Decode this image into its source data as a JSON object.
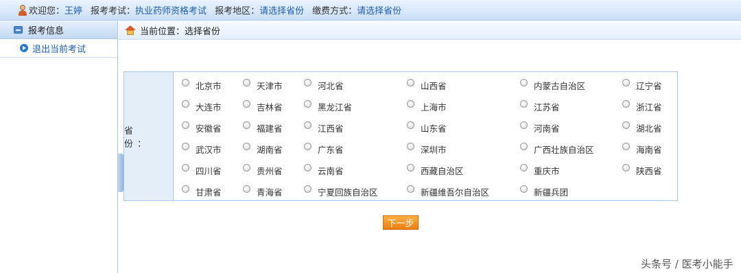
{
  "topbar": {
    "welcome_label": "欢迎您：",
    "user_name": "王婷",
    "exam_label": "报考考试：",
    "exam_value": "执业药师资格考试",
    "region_label": "报考地区：",
    "region_value": "请选择省份",
    "payment_label": "缴费方式：",
    "payment_value": "请选择省份"
  },
  "sidebar": {
    "header": "报考信息",
    "items": [
      {
        "label": "退出当前考试"
      }
    ]
  },
  "breadcrumb": {
    "text": "当前位置：选择省份"
  },
  "form": {
    "field_label": "省　份：",
    "provinces": [
      "北京市",
      "天津市",
      "河北省",
      "山西省",
      "内蒙古自治区",
      "辽宁省",
      "大连市",
      "吉林省",
      "黑龙江省",
      "上海市",
      "江苏省",
      "浙江省",
      "安徽省",
      "福建省",
      "江西省",
      "山东省",
      "河南省",
      "湖北省",
      "武汉市",
      "湖南省",
      "广东省",
      "深圳市",
      "广西壮族自治区",
      "海南省",
      "四川省",
      "贵州省",
      "云南省",
      "西藏自治区",
      "重庆市",
      "陕西省",
      "甘肃省",
      "青海省",
      "宁夏回族自治区",
      "新疆维吾尔自治区",
      "新疆兵团"
    ]
  },
  "next_button": {
    "label": "下一步"
  },
  "watermark": {
    "text": "头条号 / 医考小能手"
  }
}
